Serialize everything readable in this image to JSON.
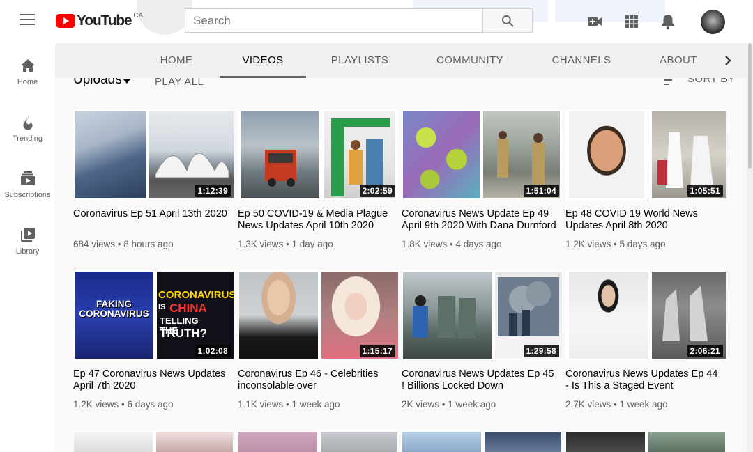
{
  "topbar": {
    "logo_text": "YouTube",
    "region": "CA",
    "search_placeholder": "Search",
    "icons": [
      "menu-icon",
      "search-icon",
      "create-video-icon",
      "apps-icon",
      "notifications-icon",
      "account-avatar"
    ]
  },
  "sidebar": {
    "items": [
      {
        "label": "Home",
        "icon": "home-icon"
      },
      {
        "label": "Trending",
        "icon": "trending-icon"
      },
      {
        "label": "Subscriptions",
        "icon": "subscriptions-icon"
      },
      {
        "label": "Library",
        "icon": "library-icon"
      }
    ]
  },
  "channel_tabs": {
    "items": [
      "HOME",
      "VIDEOS",
      "PLAYLISTS",
      "COMMUNITY",
      "CHANNELS",
      "ABOUT"
    ],
    "active": "VIDEOS"
  },
  "uploads_bar": {
    "label": "Uploads",
    "play_all": "PLAY ALL",
    "sort_by": "SORT BY"
  },
  "thumbnail_texts": {
    "faking": "FAKING CORONAVIRUS",
    "coronavirus": "CORONAVIRUS",
    "is": "IS",
    "china": "CHINA",
    "telling": "TELLING THE",
    "truth": "TRUTH?"
  },
  "videos": [
    {
      "title": "Coronavirus Ep 51 April 13th 2020",
      "views": "684 views",
      "age": "8 hours ago",
      "duration": "1:12:39"
    },
    {
      "title": "Ep 50 COVID-19 & Media Plague News Updates April 10th 2020",
      "views": "1.3K views",
      "age": "1 day ago",
      "duration": "2:02:59"
    },
    {
      "title": "Coronavirus News Update Ep 49 April 9th 2020 With Dana Durnford",
      "views": "1.8K views",
      "age": "4 days ago",
      "duration": "1:51:04"
    },
    {
      "title": "Ep 48 COVID 19 World News Updates April 8th 2020",
      "views": "1.2K views",
      "age": "5 days ago",
      "duration": "1:05:51"
    },
    {
      "title": "Ep 47 Coronavirus News Updates April 7th 2020",
      "views": "1.2K views",
      "age": "6 days ago",
      "duration": "1:02:08"
    },
    {
      "title": "Coronavirus Ep 46 - Celebrities inconsolable over",
      "views": "1.1K views",
      "age": "1 week ago",
      "duration": "1:15:17"
    },
    {
      "title": "Coronavirus News Updates Ep 45 ! Billions Locked Down",
      "views": "2K views",
      "age": "1 week ago",
      "duration": "1:29:58"
    },
    {
      "title": "Coronavirus News Updates Ep 44 - Is This a Staged Event",
      "views": "2.7K views",
      "age": "1 week ago",
      "duration": "2:06:21"
    }
  ],
  "colors": {
    "brand_red": "#ff0000",
    "text_primary": "#030303",
    "text_secondary": "#606060",
    "tab_bg": "#f1f1f1"
  }
}
